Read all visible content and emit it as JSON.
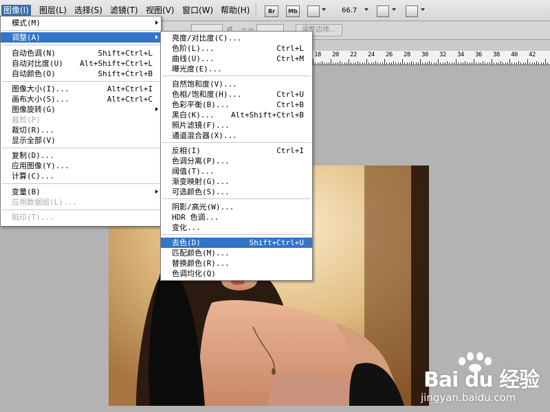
{
  "menubar": {
    "items": [
      {
        "label": "图像(I)"
      },
      {
        "label": "图层(L)"
      },
      {
        "label": "选择(S)"
      },
      {
        "label": "滤镜(T)"
      },
      {
        "label": "视图(V)"
      },
      {
        "label": "窗口(W)"
      },
      {
        "label": "帮助(H)"
      }
    ],
    "tools": {
      "br": "Br",
      "mb": "Mb"
    },
    "zoom": "66.7"
  },
  "options_bar": {
    "width_label": "宽度",
    "height_label": "高度",
    "refine_button": "调整边缘..."
  },
  "ruler": {
    "labels": [
      "18",
      "20",
      "22",
      "24",
      "26",
      "28",
      "30",
      "32",
      "34",
      "36",
      "38",
      "40",
      "42"
    ]
  },
  "image_menu": {
    "items": [
      {
        "label": "模式(M)",
        "shortcut": "",
        "submenu": true,
        "disabled": false
      },
      {
        "label": "调整(A)",
        "shortcut": "",
        "submenu": true,
        "disabled": false,
        "highlighted": true
      },
      {
        "label": "自动色调(N)",
        "shortcut": "Shift+Ctrl+L"
      },
      {
        "label": "自动对比度(U)",
        "shortcut": "Alt+Shift+Ctrl+L"
      },
      {
        "label": "自动颜色(O)",
        "shortcut": "Shift+Ctrl+B"
      },
      {
        "label": "图像大小(I)...",
        "shortcut": "Alt+Ctrl+I"
      },
      {
        "label": "画布大小(S)...",
        "shortcut": "Alt+Ctrl+C"
      },
      {
        "label": "图像旋转(G)",
        "shortcut": "",
        "submenu": true
      },
      {
        "label": "裁剪(P)",
        "shortcut": "",
        "disabled": true
      },
      {
        "label": "裁切(R)...",
        "shortcut": ""
      },
      {
        "label": "显示全部(V)",
        "shortcut": ""
      },
      {
        "label": "复制(D)...",
        "shortcut": ""
      },
      {
        "label": "应用图像(Y)...",
        "shortcut": ""
      },
      {
        "label": "计算(C)...",
        "shortcut": ""
      },
      {
        "label": "变量(B)",
        "shortcut": "",
        "submenu": true
      },
      {
        "label": "应用数据组(L)...",
        "shortcut": "",
        "disabled": true
      },
      {
        "label": "陷印(T)...",
        "shortcut": "",
        "disabled": true
      }
    ]
  },
  "adjust_menu": {
    "items": [
      {
        "label": "亮度/对比度(C)...",
        "shortcut": ""
      },
      {
        "label": "色阶(L)...",
        "shortcut": "Ctrl+L"
      },
      {
        "label": "曲线(U)...",
        "shortcut": "Ctrl+M"
      },
      {
        "label": "曝光度(E)...",
        "shortcut": ""
      },
      {
        "label": "自然饱和度(V)...",
        "shortcut": ""
      },
      {
        "label": "色相/饱和度(H)...",
        "shortcut": "Ctrl+U"
      },
      {
        "label": "色彩平衡(B)...",
        "shortcut": "Ctrl+B"
      },
      {
        "label": "黑白(K)...",
        "shortcut": "Alt+Shift+Ctrl+B"
      },
      {
        "label": "照片滤镜(F)...",
        "shortcut": ""
      },
      {
        "label": "通道混合器(X)...",
        "shortcut": ""
      },
      {
        "label": "反相(I)",
        "shortcut": "Ctrl+I"
      },
      {
        "label": "色调分离(P)...",
        "shortcut": ""
      },
      {
        "label": "阈值(T)...",
        "shortcut": ""
      },
      {
        "label": "渐变映射(G)...",
        "shortcut": ""
      },
      {
        "label": "可选颜色(S)...",
        "shortcut": ""
      },
      {
        "label": "阴影/高光(W)...",
        "shortcut": ""
      },
      {
        "label": "HDR 色调...",
        "shortcut": ""
      },
      {
        "label": "变化...",
        "shortcut": ""
      },
      {
        "label": "去色(D)",
        "shortcut": "Shift+Ctrl+U",
        "highlighted": true
      },
      {
        "label": "匹配颜色(M)...",
        "shortcut": ""
      },
      {
        "label": "替换颜色(R)...",
        "shortcut": ""
      },
      {
        "label": "色调均化(Q)",
        "shortcut": ""
      }
    ]
  },
  "watermark": {
    "logo": "Bai du 经验",
    "url": "jingyan.baidu.com"
  }
}
